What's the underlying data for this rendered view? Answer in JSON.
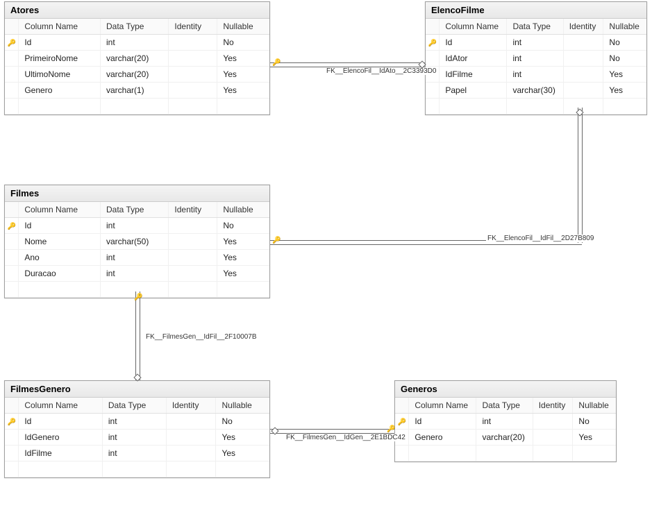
{
  "headers": {
    "col": "Column Name",
    "type": "Data Type",
    "identity": "Identity",
    "nullable": "Nullable"
  },
  "tables": {
    "atores": {
      "title": "Atores",
      "rows": [
        {
          "pk": true,
          "name": "Id",
          "type": "int",
          "identity": "",
          "nullable": "No"
        },
        {
          "pk": false,
          "name": "PrimeiroNome",
          "type": "varchar(20)",
          "identity": "",
          "nullable": "Yes"
        },
        {
          "pk": false,
          "name": "UltimoNome",
          "type": "varchar(20)",
          "identity": "",
          "nullable": "Yes"
        },
        {
          "pk": false,
          "name": "Genero",
          "type": "varchar(1)",
          "identity": "",
          "nullable": "Yes"
        }
      ]
    },
    "elencofilme": {
      "title": "ElencoFilme",
      "rows": [
        {
          "pk": true,
          "name": "Id",
          "type": "int",
          "identity": "",
          "nullable": "No"
        },
        {
          "pk": false,
          "name": "IdAtor",
          "type": "int",
          "identity": "",
          "nullable": "No"
        },
        {
          "pk": false,
          "name": "IdFilme",
          "type": "int",
          "identity": "",
          "nullable": "Yes"
        },
        {
          "pk": false,
          "name": "Papel",
          "type": "varchar(30)",
          "identity": "",
          "nullable": "Yes"
        }
      ]
    },
    "filmes": {
      "title": "Filmes",
      "rows": [
        {
          "pk": true,
          "name": "Id",
          "type": "int",
          "identity": "",
          "nullable": "No"
        },
        {
          "pk": false,
          "name": "Nome",
          "type": "varchar(50)",
          "identity": "",
          "nullable": "Yes"
        },
        {
          "pk": false,
          "name": "Ano",
          "type": "int",
          "identity": "",
          "nullable": "Yes"
        },
        {
          "pk": false,
          "name": "Duracao",
          "type": "int",
          "identity": "",
          "nullable": "Yes"
        }
      ]
    },
    "filmesgenero": {
      "title": "FilmesGenero",
      "rows": [
        {
          "pk": true,
          "name": "Id",
          "type": "int",
          "identity": "",
          "nullable": "No"
        },
        {
          "pk": false,
          "name": "IdGenero",
          "type": "int",
          "identity": "",
          "nullable": "Yes"
        },
        {
          "pk": false,
          "name": "IdFilme",
          "type": "int",
          "identity": "",
          "nullable": "Yes"
        }
      ]
    },
    "generos": {
      "title": "Generos",
      "rows": [
        {
          "pk": true,
          "name": "Id",
          "type": "int",
          "identity": "",
          "nullable": "No"
        },
        {
          "pk": false,
          "name": "Genero",
          "type": "varchar(20)",
          "identity": "",
          "nullable": "Yes"
        }
      ]
    }
  },
  "relations": {
    "elenco_ator": "FK__ElencoFil__IdAto__2C3393D0",
    "elenco_filme": "FK__ElencoFil__IdFil__2D27B809",
    "filmesgen_fil": "FK__FilmesGen__IdFil__2F10007B",
    "filmesgen_gen": "FK__FilmesGen__IdGen__2E1BDC42"
  }
}
